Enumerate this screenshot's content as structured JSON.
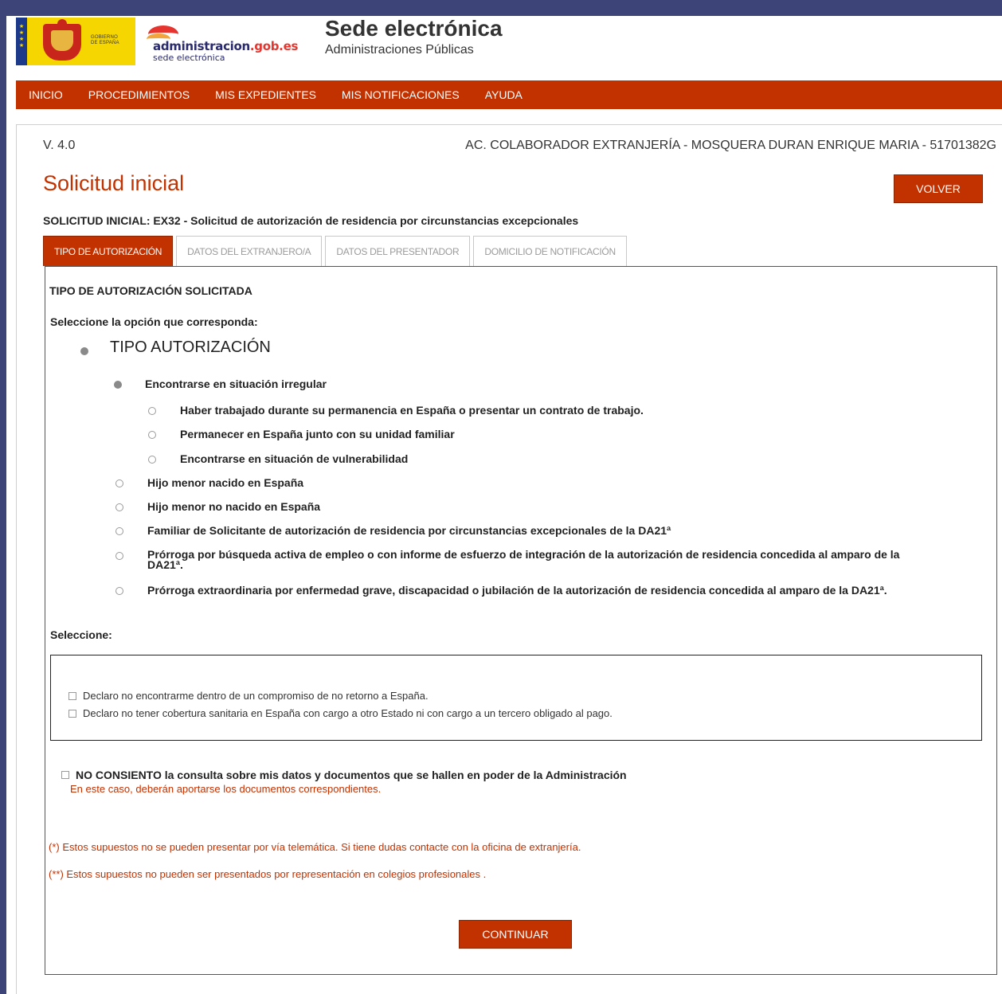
{
  "header": {
    "gob_label_1": "GOBIERNO",
    "gob_label_2": "DE ESPAÑA",
    "admin_logo_main": "administracion",
    "admin_logo_domain": ".gob.es",
    "admin_logo_sub": "sede electrónica",
    "title": "Sede electrónica",
    "subtitle": "Administraciones Públicas"
  },
  "nav": {
    "items": [
      {
        "label": "INICIO"
      },
      {
        "label": "PROCEDIMIENTOS"
      },
      {
        "label": "MIS EXPEDIENTES"
      },
      {
        "label": "MIS NOTIFICACIONES"
      },
      {
        "label": "AYUDA"
      }
    ]
  },
  "content": {
    "version": "V. 4.0",
    "user_info": "AC. COLABORADOR EXTRANJERÍA - MOSQUERA DURAN ENRIQUE MARIA - 51701382G",
    "page_title": "Solicitud inicial",
    "back_label": "VOLVER",
    "subtitle": "SOLICITUD INICIAL: EX32 - Solicitud de autorización de residencia por circunstancias excepcionales"
  },
  "tabs": [
    {
      "label": "TIPO DE AUTORIZACIÓN",
      "active": true
    },
    {
      "label": "DATOS DEL EXTRANJERO/A",
      "active": false
    },
    {
      "label": "DATOS DEL PRESENTADOR",
      "active": false
    },
    {
      "label": "DOMICILIO DE NOTIFICACIÓN",
      "active": false
    }
  ],
  "form": {
    "section_title": "TIPO DE AUTORIZACIÓN SOLICITADA",
    "instruction": "Seleccione la opción que corresponda:",
    "group_title": "TIPO AUTORIZACIÓN",
    "irregular": {
      "label": "Encontrarse en situación irregular",
      "suboptions": [
        "Haber trabajado durante su permanencia en España o presentar un contrato de trabajo.",
        "Permanecer en España junto con su unidad familiar",
        "Encontrarse en situación de vulnerabilidad"
      ]
    },
    "options": [
      "Hijo menor nacido en España",
      "Hijo menor no nacido en España",
      "Familiar de Solicitante de autorización de residencia por circunstancias excepcionales de la DA21ª",
      "Prórroga por búsqueda activa de empleo o con informe de esfuerzo de integración de la autorización de residencia concedida al amparo de la DA21ª.",
      "Prórroga extraordinaria por enfermedad grave, discapacidad o jubilación de la autorización de residencia concedida al amparo de la DA21ª."
    ],
    "select_label": "Seleccione:",
    "declarations": [
      "Declaro no encontrarme dentro de un compromiso de no retorno a España.",
      "Declaro no tener cobertura sanitaria en España con cargo a otro Estado ni con cargo a un tercero obligado al pago."
    ],
    "consent_label": "NO CONSIENTO la consulta sobre mis datos y documentos que se hallen en poder de la Administración",
    "consent_note": "En este caso, deberán aportarse los documentos correspondientes.",
    "note_1": "(*) Estos supuestos no se pueden presentar por vía telemática. Si tiene dudas contacte con la oficina de extranjería.",
    "note_2": "(**) Estos supuestos no pueden ser presentados por representación en colegios profesionales .",
    "continue_label": "CONTINUAR"
  },
  "colors": {
    "accent": "#c23100",
    "frame": "#3d4478"
  }
}
